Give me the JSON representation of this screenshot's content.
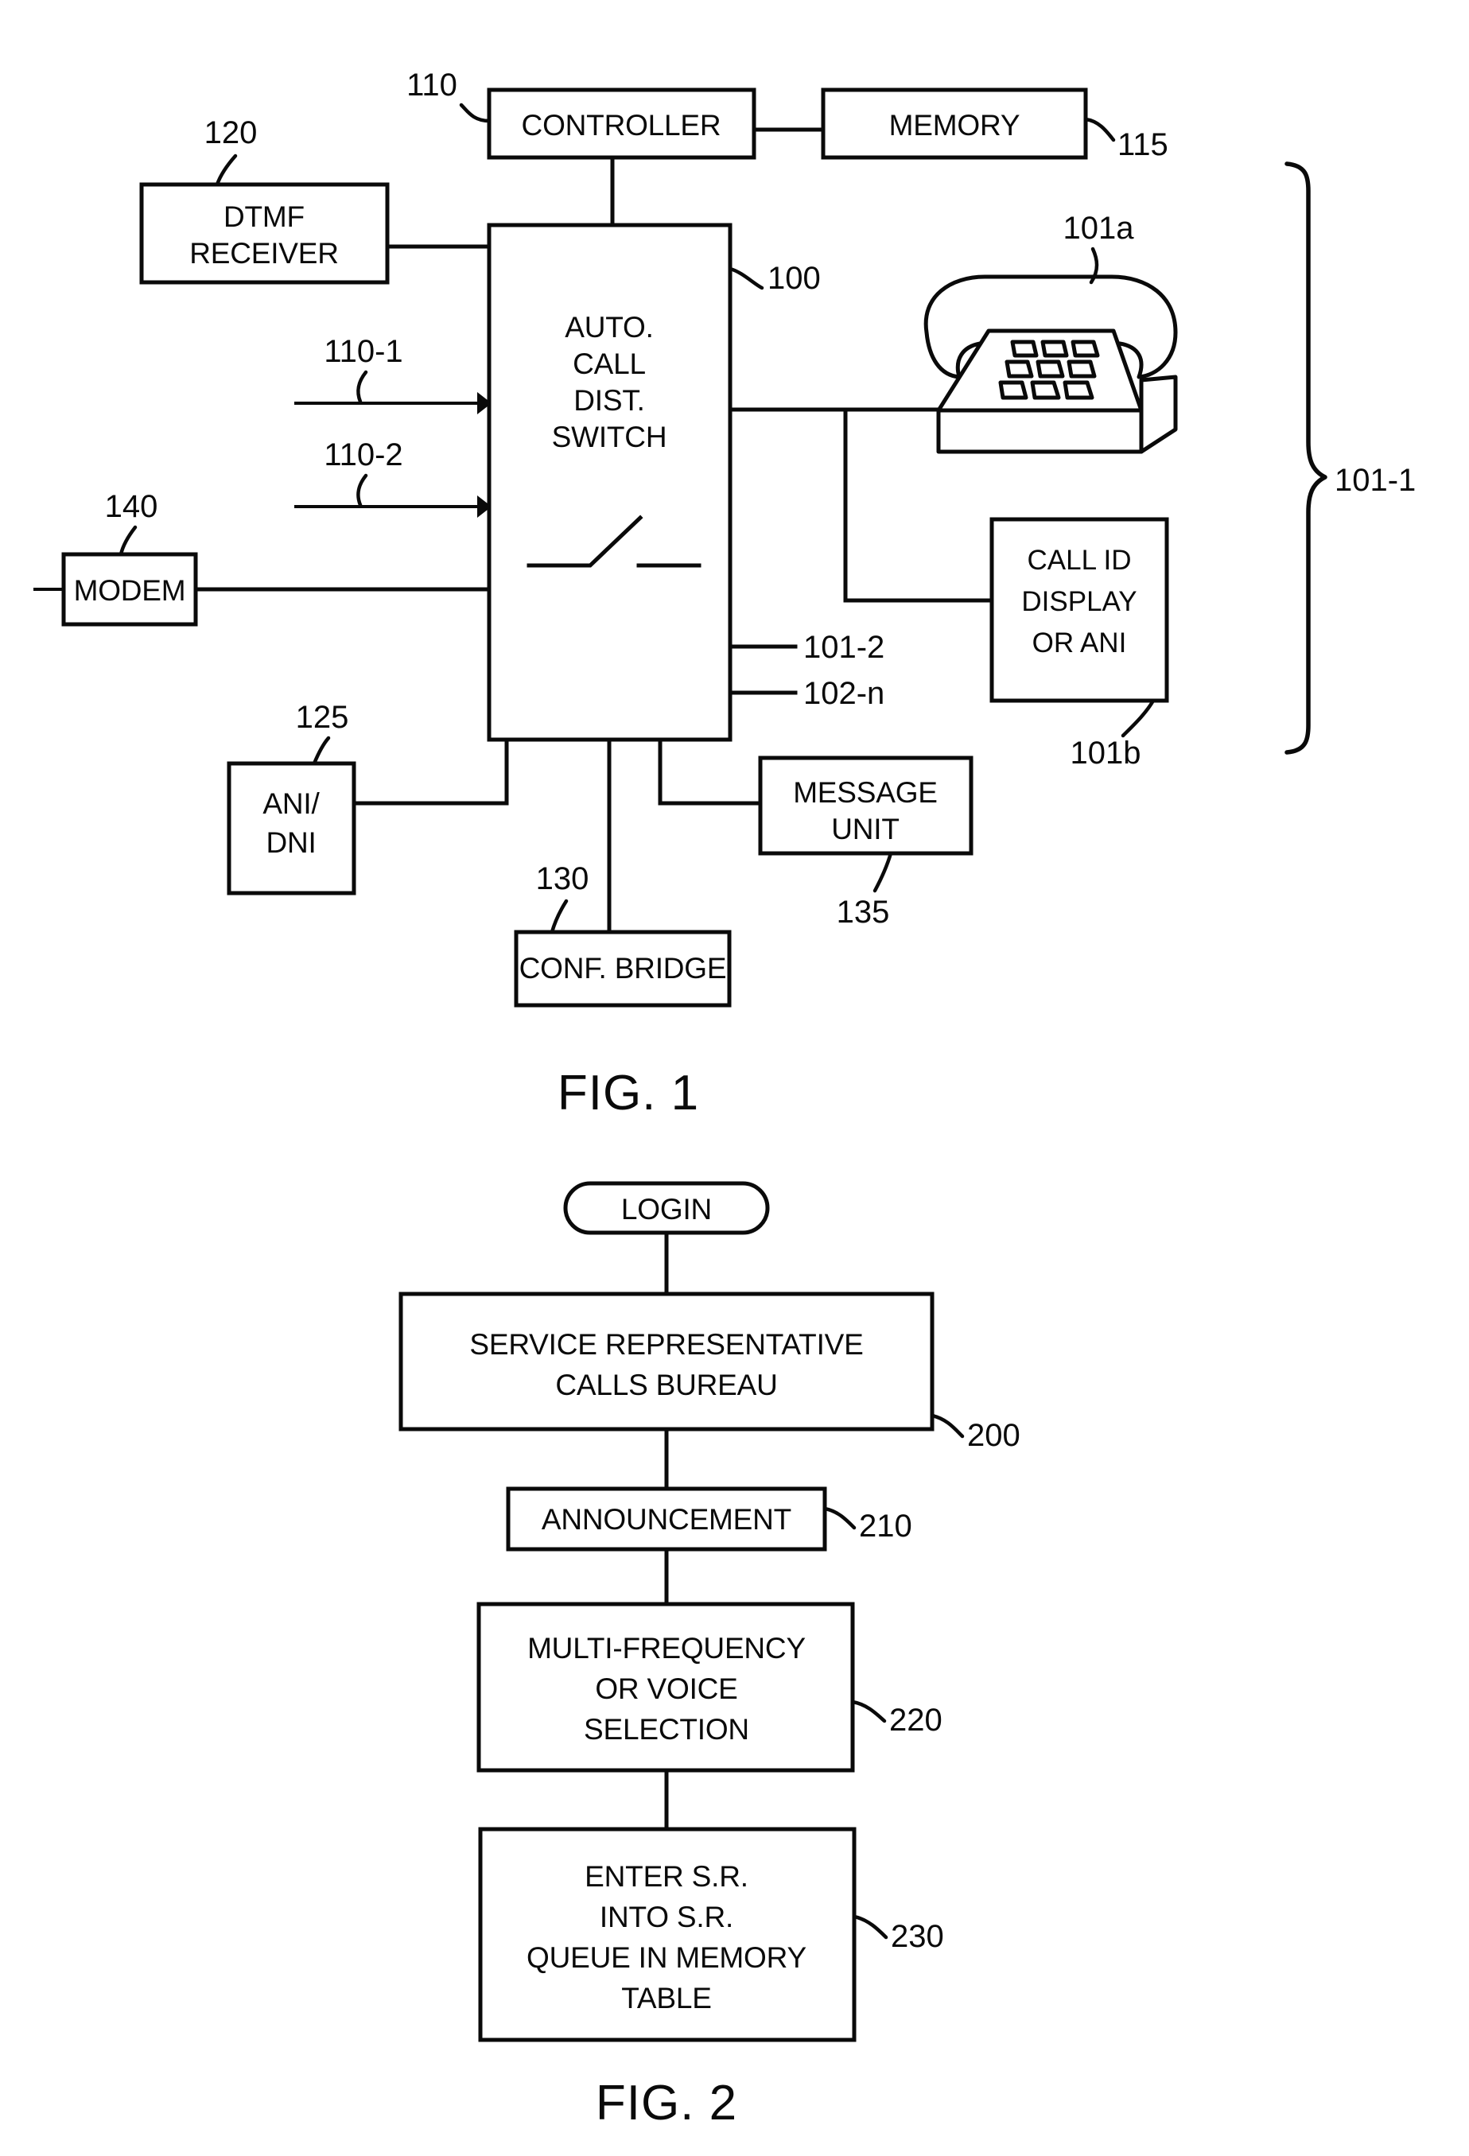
{
  "document": {
    "type": "patent-drawing-sheet",
    "figures": [
      {
        "id": "fig1",
        "title": "FIG. 1",
        "caption_ref": "FIG. 1"
      },
      {
        "id": "fig2",
        "title": "FIG. 2",
        "caption_ref": "FIG. 2"
      }
    ]
  },
  "fig1": {
    "title": "FIG. 1",
    "blocks": {
      "controller": {
        "label": "CONTROLLER",
        "ref": "110"
      },
      "memory": {
        "label": "MEMORY",
        "ref": "115"
      },
      "dtmf_receiver": {
        "label_line1": "DTMF",
        "label_line2": "RECEIVER",
        "ref": "120"
      },
      "acd_switch": {
        "label_line1": "AUTO.",
        "label_line2": "CALL",
        "label_line3": "DIST.",
        "label_line4": "SWITCH",
        "ref": "100"
      },
      "modem": {
        "label": "MODEM",
        "ref": "140"
      },
      "ani_dni": {
        "label_line1": "ANI/",
        "label_line2": "DNI",
        "ref": "125"
      },
      "conf_bridge": {
        "label": "CONF. BRIDGE",
        "ref": "130"
      },
      "message_unit": {
        "label_line1": "MESSAGE",
        "label_line2": "UNIT",
        "ref": "135"
      },
      "call_id_display": {
        "label_line1": "CALL ID",
        "label_line2": "DISPLAY",
        "label_line3": "OR ANI",
        "ref": "101b"
      },
      "telephone": {
        "icon": "desk-telephone-icon",
        "ref": "101a"
      }
    },
    "trunk_labels": {
      "trunk_1": "110-1",
      "trunk_2": "110-2"
    },
    "line_labels": {
      "line_101_2": "101-2",
      "line_102_n": "102-n"
    },
    "group_brace": {
      "ref": "101-1"
    }
  },
  "fig2": {
    "title": "FIG. 2",
    "start": {
      "label": "LOGIN"
    },
    "steps": [
      {
        "ref": "200",
        "lines": [
          "SERVICE REPRESENTATIVE",
          "CALLS BUREAU"
        ]
      },
      {
        "ref": "210",
        "lines": [
          "ANNOUNCEMENT"
        ]
      },
      {
        "ref": "220",
        "lines": [
          "MULTI-FREQUENCY",
          "OR VOICE",
          "SELECTION"
        ]
      },
      {
        "ref": "230",
        "lines": [
          "ENTER S.R.",
          "INTO S.R.",
          "QUEUE IN MEMORY",
          "TABLE"
        ]
      }
    ]
  },
  "colors": {
    "ink": "#0a0a0a",
    "paper": "#ffffff"
  }
}
